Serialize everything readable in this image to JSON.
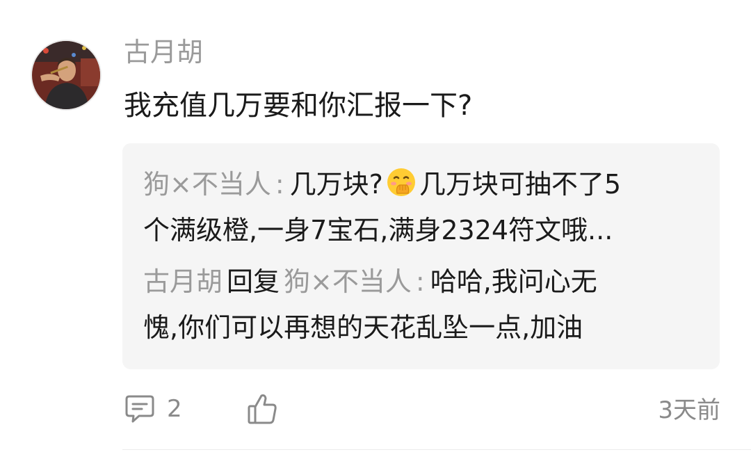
{
  "comment": {
    "username": "古月胡",
    "content": "我充值几万要和你汇报一下?",
    "avatar_icon": "user-avatar-photo"
  },
  "replies": [
    {
      "nickname": "狗×不当人",
      "colon": ":",
      "text_before_emoji": "几万块?",
      "emoji": "hand-over-mouth-emoji",
      "line1_after_emoji": "几万块可抽不了5",
      "line2": "个满级橙,一身7宝石,满身2324符文哦..."
    },
    {
      "nickname": "古月胡",
      "reply_word": "回复",
      "target_nickname": "狗×不当人",
      "colon": ":",
      "line1_text": "哈哈,我问心无",
      "line2": "愧,你们可以再想的天花乱坠一点,加油"
    }
  ],
  "actions": {
    "comment_icon": "comment-bubble-icon",
    "comment_count": "2",
    "like_icon": "thumbs-up-icon",
    "time": "3天前"
  },
  "colors": {
    "muted": "#9a9a9a",
    "text": "#1a1a1a",
    "reply_bg": "#f5f5f5"
  }
}
